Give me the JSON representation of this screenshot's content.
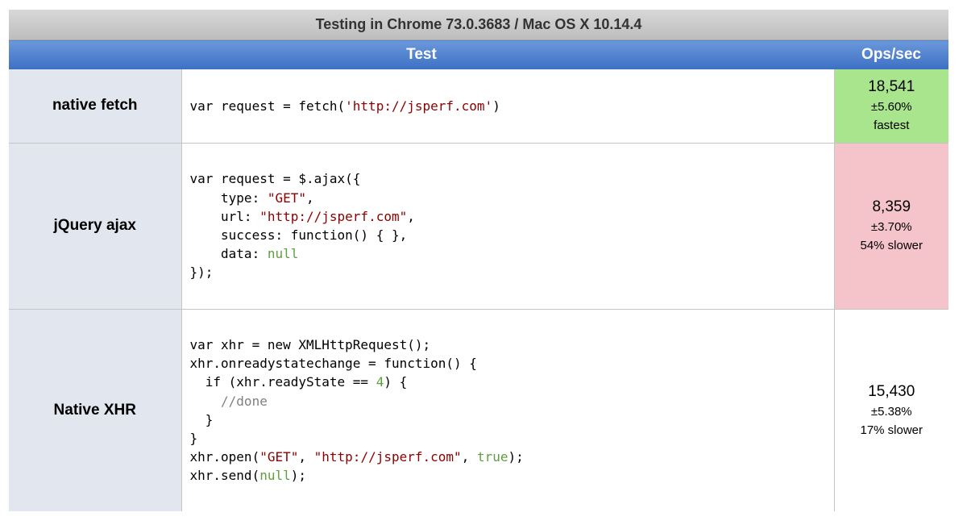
{
  "caption": "Testing in Chrome 73.0.3683 / Mac OS X 10.14.4",
  "headers": {
    "test": "Test",
    "ops": "Ops/sec"
  },
  "colors": {
    "fastest": "#a9e58c",
    "slowest": "#f5c4cb",
    "normal": "#ffffff"
  },
  "rows": [
    {
      "name": "native fetch",
      "code": {
        "l1_a": "var request = fetch(",
        "l1_s": "'http://jsperf.com'",
        "l1_b": ")"
      },
      "ops": "18,541",
      "error": "±5.60%",
      "relative": "fastest",
      "status": "fastest"
    },
    {
      "name": "jQuery ajax",
      "code": {
        "l1": "var request = $.ajax({",
        "l2_a": "    type: ",
        "l2_s": "\"GET\"",
        "l2_b": ",",
        "l3_a": "    url: ",
        "l3_s": "\"http://jsperf.com\"",
        "l3_b": ",",
        "l4": "    success: function() { },",
        "l5_a": "    data: ",
        "l5_k": "null",
        "l6": "});"
      },
      "ops": "8,359",
      "error": "±3.70%",
      "relative": "54% slower",
      "status": "slowest"
    },
    {
      "name": "Native XHR",
      "code": {
        "l1": "var xhr = new XMLHttpRequest();",
        "l2": "xhr.onreadystatechange = function() {",
        "l3_a": "  if (xhr.readyState == ",
        "l3_k": "4",
        "l3_b": ") {",
        "l4": "    //done",
        "l5": "  }",
        "l6": "}",
        "l7_a": "xhr.open(",
        "l7_s1": "\"GET\"",
        "l7_b": ", ",
        "l7_s2": "\"http://jsperf.com\"",
        "l7_c": ", ",
        "l7_k": "true",
        "l7_d": ");",
        "l8_a": "xhr.send(",
        "l8_k": "null",
        "l8_b": ");"
      },
      "ops": "15,430",
      "error": "±5.38%",
      "relative": "17% slower",
      "status": "normal"
    }
  ]
}
